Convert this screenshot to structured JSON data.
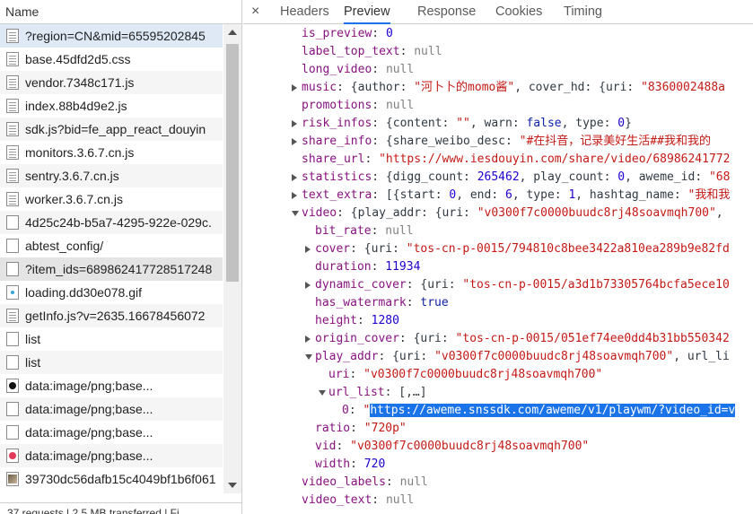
{
  "left_panel": {
    "header": "Name",
    "requests": [
      {
        "name": "?region=CN&mid=65595202845",
        "icon": "doc",
        "state": "sel"
      },
      {
        "name": "base.45dfd2d5.css",
        "icon": "doc",
        "state": ""
      },
      {
        "name": "vendor.7348c171.js",
        "icon": "doc",
        "state": "alt"
      },
      {
        "name": "index.88b4d9e2.js",
        "icon": "doc",
        "state": ""
      },
      {
        "name": "sdk.js?bid=fe_app_react_douyin",
        "icon": "doc",
        "state": "alt"
      },
      {
        "name": "monitors.3.6.7.cn.js",
        "icon": "doc",
        "state": ""
      },
      {
        "name": "sentry.3.6.7.cn.js",
        "icon": "doc",
        "state": "alt"
      },
      {
        "name": "worker.3.6.7.cn.js",
        "icon": "doc",
        "state": ""
      },
      {
        "name": "4d25c24b-b5a7-4295-922e-029c.",
        "icon": "blank",
        "state": "alt"
      },
      {
        "name": "abtest_config/",
        "icon": "blank",
        "state": ""
      },
      {
        "name": "?item_ids=689862417728517248",
        "icon": "blank",
        "state": "gray"
      },
      {
        "name": "loading.dd30e078.gif",
        "icon": "img",
        "state": ""
      },
      {
        "name": "getInfo.js?v=2635.16678456072",
        "icon": "doc",
        "state": "alt"
      },
      {
        "name": "list",
        "icon": "blank",
        "state": ""
      },
      {
        "name": "list",
        "icon": "blank",
        "state": "alt"
      },
      {
        "name": "data:image/png;base...",
        "icon": "tiktok",
        "state": ""
      },
      {
        "name": "data:image/png;base...",
        "icon": "blank",
        "state": "alt"
      },
      {
        "name": "data:image/png;base...",
        "icon": "blank",
        "state": ""
      },
      {
        "name": "data:image/png;base...",
        "icon": "red",
        "state": "alt"
      },
      {
        "name": "39730dc56dafb15c4049bf1b6f061",
        "icon": "photo",
        "state": ""
      }
    ],
    "status_text": "37 requests | 2.5 MB transferred | Fi"
  },
  "tabs": {
    "close_label": "×",
    "items": [
      "Headers",
      "Preview",
      "Response",
      "Cookies",
      "Timing"
    ],
    "active": "Preview"
  },
  "json_lines": [
    {
      "indent": 0,
      "tri": "",
      "parts": [
        [
          "k",
          "is_preview"
        ],
        [
          "p",
          ": "
        ],
        [
          "n",
          "0"
        ]
      ]
    },
    {
      "indent": 0,
      "tri": "",
      "parts": [
        [
          "k",
          "label_top_text"
        ],
        [
          "p",
          ": "
        ],
        [
          "nl",
          "null"
        ]
      ]
    },
    {
      "indent": 0,
      "tri": "",
      "parts": [
        [
          "k",
          "long_video"
        ],
        [
          "p",
          ": "
        ],
        [
          "nl",
          "null"
        ]
      ]
    },
    {
      "indent": 0,
      "tri": "r",
      "parts": [
        [
          "k",
          "music"
        ],
        [
          "p",
          ": {author: "
        ],
        [
          "s",
          "\"河卜卜的momo酱\""
        ],
        [
          "p",
          ", cover_hd: {uri: "
        ],
        [
          "s",
          "\"8360002488a"
        ]
      ]
    },
    {
      "indent": 0,
      "tri": "",
      "parts": [
        [
          "k",
          "promotions"
        ],
        [
          "p",
          ": "
        ],
        [
          "nl",
          "null"
        ]
      ]
    },
    {
      "indent": 0,
      "tri": "r",
      "parts": [
        [
          "k",
          "risk_infos"
        ],
        [
          "p",
          ": {content: "
        ],
        [
          "s",
          "\"\""
        ],
        [
          "p",
          ", warn: "
        ],
        [
          "b",
          "false"
        ],
        [
          "p",
          ", type: "
        ],
        [
          "n",
          "0"
        ],
        [
          "p",
          "}"
        ]
      ]
    },
    {
      "indent": 0,
      "tri": "r",
      "parts": [
        [
          "k",
          "share_info"
        ],
        [
          "p",
          ": {share_weibo_desc: "
        ],
        [
          "s",
          "\"#在抖音，记录美好生活##我和我的"
        ]
      ]
    },
    {
      "indent": 0,
      "tri": "",
      "parts": [
        [
          "k",
          "share_url"
        ],
        [
          "p",
          ": "
        ],
        [
          "s",
          "\"https://www.iesdouyin.com/share/video/68986241772"
        ]
      ]
    },
    {
      "indent": 0,
      "tri": "r",
      "parts": [
        [
          "k",
          "statistics"
        ],
        [
          "p",
          ": {digg_count: "
        ],
        [
          "n",
          "265462"
        ],
        [
          "p",
          ", play_count: "
        ],
        [
          "n",
          "0"
        ],
        [
          "p",
          ", aweme_id: "
        ],
        [
          "s",
          "\"68"
        ]
      ]
    },
    {
      "indent": 0,
      "tri": "r",
      "parts": [
        [
          "k",
          "text_extra"
        ],
        [
          "p",
          ": [{start: "
        ],
        [
          "n",
          "0"
        ],
        [
          "p",
          ", end: "
        ],
        [
          "n",
          "6"
        ],
        [
          "p",
          ", type: "
        ],
        [
          "n",
          "1"
        ],
        [
          "p",
          ", hashtag_name: "
        ],
        [
          "s",
          "\"我和我"
        ]
      ]
    },
    {
      "indent": 0,
      "tri": "d",
      "parts": [
        [
          "k",
          "video"
        ],
        [
          "p",
          ": {play_addr: {uri: "
        ],
        [
          "s",
          "\"v0300f7c0000buudc8rj48soavmqh700\""
        ],
        [
          "p",
          ","
        ]
      ]
    },
    {
      "indent": 1,
      "tri": "",
      "parts": [
        [
          "k",
          "bit_rate"
        ],
        [
          "p",
          ": "
        ],
        [
          "nl",
          "null"
        ]
      ]
    },
    {
      "indent": 1,
      "tri": "r",
      "parts": [
        [
          "k",
          "cover"
        ],
        [
          "p",
          ": {uri: "
        ],
        [
          "s",
          "\"tos-cn-p-0015/794810c8bee3422a810ea289b9e82fd"
        ]
      ]
    },
    {
      "indent": 1,
      "tri": "",
      "parts": [
        [
          "k",
          "duration"
        ],
        [
          "p",
          ": "
        ],
        [
          "n",
          "11934"
        ]
      ]
    },
    {
      "indent": 1,
      "tri": "r",
      "parts": [
        [
          "k",
          "dynamic_cover"
        ],
        [
          "p",
          ": {uri: "
        ],
        [
          "s",
          "\"tos-cn-p-0015/a3d1b73305764bcfa5ece10"
        ]
      ]
    },
    {
      "indent": 1,
      "tri": "",
      "parts": [
        [
          "k",
          "has_watermark"
        ],
        [
          "p",
          ": "
        ],
        [
          "b",
          "true"
        ]
      ]
    },
    {
      "indent": 1,
      "tri": "",
      "parts": [
        [
          "k",
          "height"
        ],
        [
          "p",
          ": "
        ],
        [
          "n",
          "1280"
        ]
      ]
    },
    {
      "indent": 1,
      "tri": "r",
      "parts": [
        [
          "k",
          "origin_cover"
        ],
        [
          "p",
          ": {uri: "
        ],
        [
          "s",
          "\"tos-cn-p-0015/051ef74ee0dd4b31bb550342"
        ]
      ]
    },
    {
      "indent": 1,
      "tri": "d",
      "parts": [
        [
          "k",
          "play_addr"
        ],
        [
          "p",
          ": {uri: "
        ],
        [
          "s",
          "\"v0300f7c0000buudc8rj48soavmqh700\""
        ],
        [
          "p",
          ", url_li"
        ]
      ]
    },
    {
      "indent": 2,
      "tri": "",
      "parts": [
        [
          "k",
          "uri"
        ],
        [
          "p",
          ": "
        ],
        [
          "s",
          "\"v0300f7c0000buudc8rj48soavmqh700\""
        ]
      ]
    },
    {
      "indent": 2,
      "tri": "d",
      "parts": [
        [
          "k",
          "url_list"
        ],
        [
          "p",
          ": [,…]"
        ]
      ]
    },
    {
      "indent": 3,
      "tri": "",
      "parts": [
        [
          "k",
          "0"
        ],
        [
          "p",
          ": "
        ],
        [
          "s",
          "\""
        ],
        [
          "hl",
          "https://aweme.snssdk.com/aweme/v1/playwm/?video_id=v"
        ]
      ]
    },
    {
      "indent": 1,
      "tri": "",
      "parts": [
        [
          "k",
          "ratio"
        ],
        [
          "p",
          ": "
        ],
        [
          "s",
          "\"720p\""
        ]
      ]
    },
    {
      "indent": 1,
      "tri": "",
      "parts": [
        [
          "k",
          "vid"
        ],
        [
          "p",
          ": "
        ],
        [
          "s",
          "\"v0300f7c0000buudc8rj48soavmqh700\""
        ]
      ]
    },
    {
      "indent": 1,
      "tri": "",
      "parts": [
        [
          "k",
          "width"
        ],
        [
          "p",
          ": "
        ],
        [
          "n",
          "720"
        ]
      ]
    },
    {
      "indent": 0,
      "tri": "",
      "parts": [
        [
          "k",
          "video_labels"
        ],
        [
          "p",
          ": "
        ],
        [
          "nl",
          "null"
        ]
      ]
    },
    {
      "indent": 0,
      "tri": "",
      "parts": [
        [
          "k",
          "video_text"
        ],
        [
          "p",
          ": "
        ],
        [
          "nl",
          "null"
        ]
      ]
    }
  ]
}
